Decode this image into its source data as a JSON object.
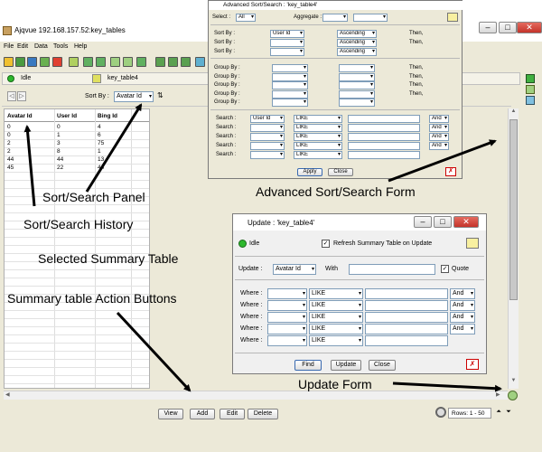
{
  "main": {
    "title": "Ajqvue  192.168.157.52:key_tables",
    "menu": [
      "File",
      "Edit",
      "Data",
      "Tools",
      "Help"
    ],
    "status": "Idle",
    "tab": "key_table4",
    "sort_by_label": "Sort By :",
    "sort_by_value": "Avatar Id",
    "table": {
      "headers": [
        "Avatar Id",
        "User Id",
        "Bing Id"
      ],
      "rows": [
        [
          "0",
          "0",
          "4"
        ],
        [
          "0",
          "1",
          "6"
        ],
        [
          "2",
          "3",
          "75"
        ],
        [
          "2",
          "8",
          "1"
        ],
        [
          "44",
          "44",
          "13"
        ],
        [
          "45",
          "22",
          "44"
        ]
      ]
    },
    "buttons": [
      "View",
      "Add",
      "Edit",
      "Delete"
    ],
    "rows_info": "Rows: 1 - 50"
  },
  "adv": {
    "title": "Advanced Sort/Search : 'key_table4'",
    "select_label": "Select :",
    "select_value": "All",
    "aggregate_label": "Aggregate :",
    "sort_label": "Sort By :",
    "sort_rows": [
      {
        "field": "User Id",
        "order": "Ascending",
        "then": "Then,"
      },
      {
        "field": "",
        "order": "Ascending",
        "then": "Then,"
      },
      {
        "field": "",
        "order": "Ascending",
        "then": ""
      }
    ],
    "group_label": "Group By :",
    "group_rows": [
      {
        "then": "Then,"
      },
      {
        "then": "Then,"
      },
      {
        "then": "Then,"
      },
      {
        "then": "Then,"
      },
      {
        "then": ""
      }
    ],
    "search_label": "Search :",
    "search_rows": [
      {
        "field": "User Id",
        "op": "LIKE",
        "logic": "And"
      },
      {
        "field": "",
        "op": "LIKE",
        "logic": "And"
      },
      {
        "field": "",
        "op": "LIKE",
        "logic": "And"
      },
      {
        "field": "",
        "op": "LIKE",
        "logic": "And"
      },
      {
        "field": "",
        "op": "LIKE",
        "logic": ""
      }
    ],
    "apply": "Apply",
    "close": "Close"
  },
  "upd": {
    "title": "Update : 'key_table4'",
    "status": "Idle",
    "refresh_label": "Refresh Summary Table on Update",
    "update_label": "Update :",
    "update_field": "Avatar Id",
    "with_label": "With",
    "quote_label": "Quote",
    "where_label": "Where :",
    "where_rows": [
      {
        "op": "LIKE",
        "logic": "And"
      },
      {
        "op": "LIKE",
        "logic": "And"
      },
      {
        "op": "LIKE",
        "logic": "And"
      },
      {
        "op": "LIKE",
        "logic": "And"
      },
      {
        "op": "LIKE",
        "logic": ""
      }
    ],
    "find": "Find",
    "update": "Update",
    "close": "Close"
  },
  "annotations": {
    "sort_panel": "Sort/Search Panel",
    "history": "Sort/Search History",
    "summary": "Selected Summary Table",
    "actions": "Summary table Action Buttons",
    "adv_form": "Advanced Sort/Search Form",
    "update_form": "Update Form"
  }
}
